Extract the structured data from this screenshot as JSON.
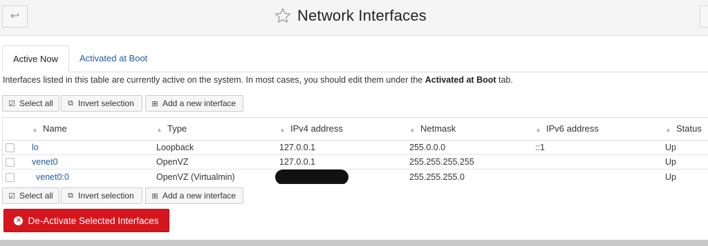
{
  "header": {
    "back_icon": "arrow-left-icon",
    "title": "Network Interfaces",
    "favorite_icon": "star-outline-icon"
  },
  "tabs": [
    {
      "label": "Active Now",
      "active": true
    },
    {
      "label": "Activated at Boot",
      "active": false
    }
  ],
  "description": {
    "prefix": "Interfaces listed in this table are currently active on the system. In most cases, you should edit them under the ",
    "link": "Activated at Boot",
    "suffix": " tab."
  },
  "actions": {
    "select_all": "Select all",
    "invert_selection": "Invert selection",
    "add_interface": "Add a new interface"
  },
  "table": {
    "columns": [
      "Name",
      "Type",
      "IPv4 address",
      "Netmask",
      "IPv6 address",
      "Status"
    ],
    "rows": [
      {
        "name": "lo",
        "type": "Loopback",
        "ipv4": "127.0.0.1",
        "netmask": "255.0.0.0",
        "ipv6": "::1",
        "status": "Up"
      },
      {
        "name": "venet0",
        "type": "OpenVZ",
        "ipv4": "127.0.0.1",
        "netmask": "255.255.255.255",
        "ipv6": "",
        "status": "Up"
      },
      {
        "name": "venet0:0",
        "type": "OpenVZ (Virtualmin)",
        "ipv4": "",
        "netmask": "255.255.255.0",
        "ipv6": "",
        "status": "Up"
      }
    ]
  },
  "deactivate_button": "De-Activate Selected Interfaces",
  "colors": {
    "link": "#1c5c9e",
    "danger": "#d6161e",
    "header_bg": "#f5f5f5"
  }
}
